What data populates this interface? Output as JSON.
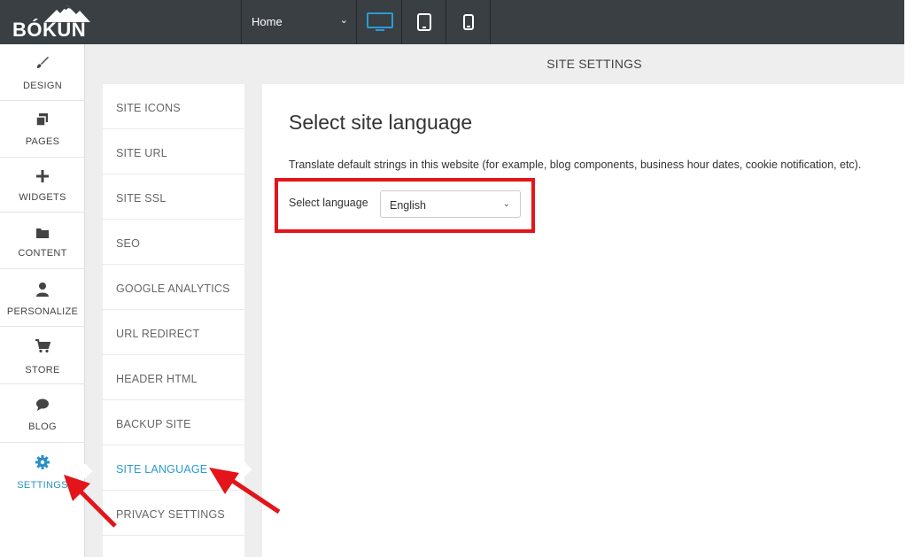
{
  "app": {
    "logo_text": "BÓKUN"
  },
  "toolbar": {
    "page_select_value": "Home",
    "devices": [
      {
        "name": "desktop",
        "active": true
      },
      {
        "name": "tablet",
        "active": false
      },
      {
        "name": "mobile",
        "active": false
      }
    ]
  },
  "sidebar": {
    "items": [
      {
        "label": "DESIGN",
        "icon": "brush-icon"
      },
      {
        "label": "PAGES",
        "icon": "pages-icon"
      },
      {
        "label": "WIDGETS",
        "icon": "plus-icon"
      },
      {
        "label": "CONTENT",
        "icon": "folder-icon"
      },
      {
        "label": "PERSONALIZE",
        "icon": "user-icon"
      },
      {
        "label": "STORE",
        "icon": "cart-icon"
      },
      {
        "label": "BLOG",
        "icon": "comment-icon"
      },
      {
        "label": "SETTINGS",
        "icon": "gear-icon",
        "active": true
      }
    ]
  },
  "section": {
    "title": "SITE SETTINGS"
  },
  "settings_menu": {
    "items": [
      {
        "label": "SITE ICONS"
      },
      {
        "label": "SITE URL"
      },
      {
        "label": "SITE SSL"
      },
      {
        "label": "SEO"
      },
      {
        "label": "GOOGLE ANALYTICS"
      },
      {
        "label": "URL REDIRECT"
      },
      {
        "label": "HEADER HTML"
      },
      {
        "label": "BACKUP SITE"
      },
      {
        "label": "SITE LANGUAGE",
        "active": true
      },
      {
        "label": "PRIVACY SETTINGS"
      }
    ]
  },
  "panel": {
    "title": "Select site language",
    "description": "Translate default strings in this website (for example, blog components, business hour dates, cookie notification, etc).",
    "language_label": "Select language",
    "language_value": "English"
  },
  "colors": {
    "accent": "#2a9bd3",
    "topbar": "#3a3f44",
    "annotation": "#e3151a"
  }
}
